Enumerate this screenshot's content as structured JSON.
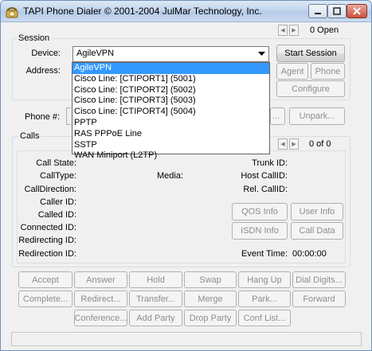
{
  "window": {
    "title": "TAPI Phone Dialer © 2001-2004 JulMar Technology, Inc.",
    "open_count": "0 Open"
  },
  "session": {
    "group_label": "Session",
    "device_label": "Device:",
    "address_label": "Address:",
    "device_value": "AgileVPN",
    "device_options": [
      "AgileVPN",
      "Cisco Line: [CTIPORT1] (5001)",
      "Cisco Line: [CTIPORT2] (5002)",
      "Cisco Line: [CTIPORT3] (5003)",
      "Cisco Line: [CTIPORT4] (5004)",
      "PPTP",
      "RAS PPPoE Line",
      "SSTP",
      "WAN Miniport (L2TP)"
    ],
    "start_session": "Start Session",
    "agent": "Agent",
    "phone": "Phone",
    "configure": "Configure"
  },
  "phone": {
    "label": "Phone #:",
    "park_partial": "...",
    "unpark": "Unpark..."
  },
  "calls": {
    "group_label": "Calls",
    "count": "0 of 0",
    "call_state": "Call State:",
    "call_type": "CallType:",
    "call_direction": "CallDirection:",
    "caller_id": "Caller ID:",
    "called_id": "Called ID:",
    "connected_id": "Connected ID:",
    "redirecting_id": "Redirecting ID:",
    "redirection_id": "Redirection ID:",
    "media": "Media:",
    "trunk_id": "Trunk ID:",
    "host_callid": "Host CallID:",
    "rel_callid": "Rel. CallID:",
    "event_time_label": "Event Time:",
    "event_time_value": "00:00:00",
    "qos_info": "QOS Info",
    "user_info": "User Info",
    "isdn_info": "ISDN Info",
    "call_data": "Call Data"
  },
  "actions": {
    "row1": [
      "Accept",
      "Answer",
      "Hold",
      "Swap",
      "Hang Up",
      "Dial Digits..."
    ],
    "row2": [
      "Complete...",
      "Redirect...",
      "Transfer...",
      "Merge",
      "Park...",
      "Forward"
    ],
    "row3": [
      "Conference...",
      "Add Party",
      "Drop Party",
      "Conf List..."
    ]
  }
}
